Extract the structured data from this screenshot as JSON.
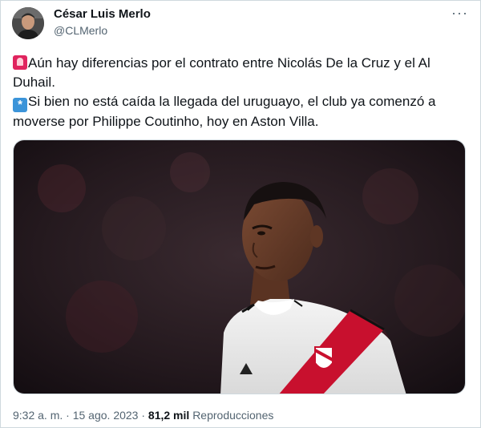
{
  "author": {
    "name": "César Luis Merlo",
    "handle": "@CLMerlo"
  },
  "menu": {
    "more_label": "···"
  },
  "tweet": {
    "line1": "Aún hay diferencias por el contrato entre Nicolás De la Cruz y el Al Duhail.",
    "line2": "Si bien no está caída la llegada del uruguayo, el club ya comenzó a moverse por Philippe Coutinho, hoy en Aston Villa.",
    "emoji1": "police-siren-icon",
    "emoji2": "eight-spoked-asterisk-icon"
  },
  "meta": {
    "time": "9:32 a. m.",
    "separator": "·",
    "date": "15 ago. 2023",
    "views": "81,2 mil",
    "views_label": "Reproducciones"
  },
  "colors": {
    "text": "#0f1419",
    "secondary": "#536471",
    "border": "#cfd9de",
    "jersey_red": "#c8102e"
  }
}
